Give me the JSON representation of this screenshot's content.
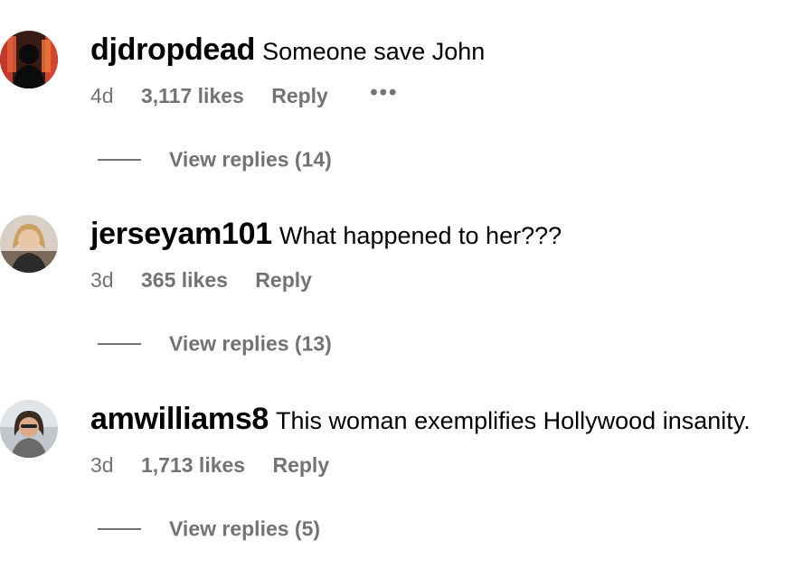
{
  "comments": [
    {
      "username": "djdropdead",
      "text": "Someone save John",
      "time": "4d",
      "likes": "3,117 likes",
      "reply_label": "Reply",
      "more_label": "•••",
      "view_replies": "View replies (14)"
    },
    {
      "username": "jerseyam101",
      "text": "What happened to her???",
      "time": "3d",
      "likes": "365 likes",
      "reply_label": "Reply",
      "view_replies": "View replies (13)"
    },
    {
      "username": "amwilliams8",
      "text": "This woman exemplifies Hollywood insanity.",
      "time": "3d",
      "likes": "1,713 likes",
      "reply_label": "Reply",
      "view_replies": "View replies (5)"
    }
  ],
  "colors": {
    "text": "#000000",
    "secondary": "#737373",
    "background": "#ffffff"
  }
}
